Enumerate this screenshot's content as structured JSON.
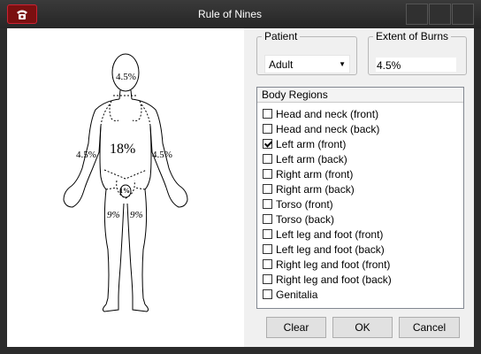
{
  "window": {
    "title": "Rule of Nines",
    "app_icon": "telephone-icon"
  },
  "figure": {
    "labels": {
      "head": "4.5%",
      "torso": "18%",
      "left_arm": "4.5%",
      "right_arm": "4.5%",
      "genitalia": "1%",
      "left_leg": "9%",
      "right_leg": "9%"
    }
  },
  "patient": {
    "legend": "Patient",
    "selected": "Adult"
  },
  "extent": {
    "legend": "Extent of Burns",
    "value": "4.5%"
  },
  "regions": {
    "header": "Body Regions",
    "items": [
      {
        "label": "Head and neck (front)",
        "checked": false
      },
      {
        "label": "Head and neck (back)",
        "checked": false
      },
      {
        "label": "Left arm (front)",
        "checked": true
      },
      {
        "label": "Left arm (back)",
        "checked": false
      },
      {
        "label": "Right arm (front)",
        "checked": false
      },
      {
        "label": "Right arm (back)",
        "checked": false
      },
      {
        "label": "Torso (front)",
        "checked": false
      },
      {
        "label": "Torso (back)",
        "checked": false
      },
      {
        "label": "Left leg and foot (front)",
        "checked": false
      },
      {
        "label": "Left leg and foot (back)",
        "checked": false
      },
      {
        "label": "Right leg and foot (front)",
        "checked": false
      },
      {
        "label": "Right leg and foot (back)",
        "checked": false
      },
      {
        "label": "Genitalia",
        "checked": false
      }
    ]
  },
  "buttons": {
    "clear": "Clear",
    "ok": "OK",
    "cancel": "Cancel"
  }
}
